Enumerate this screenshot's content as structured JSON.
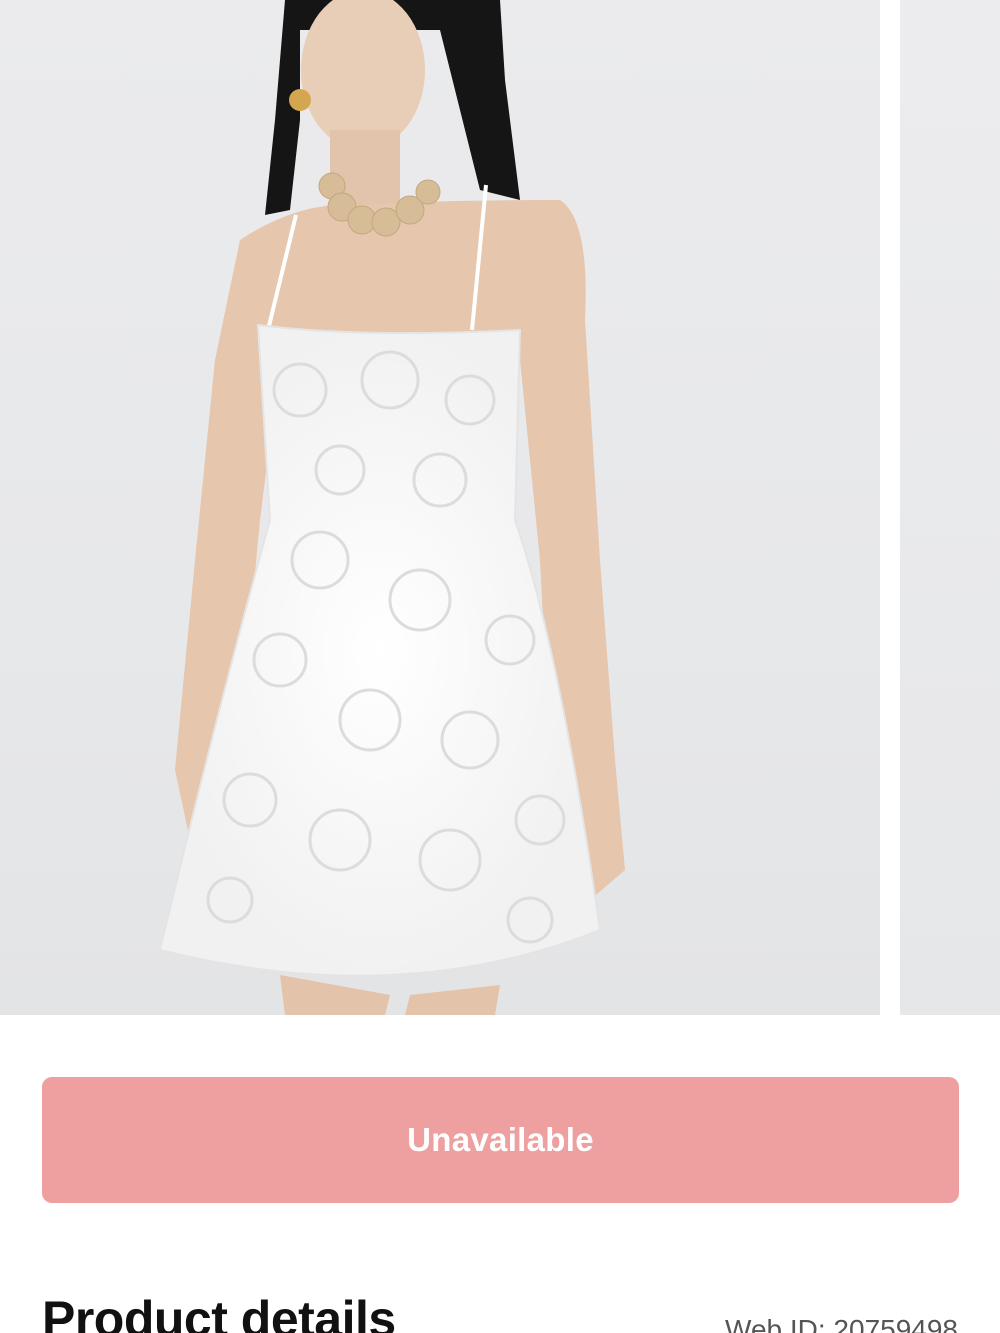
{
  "gallery": {
    "current_image": "model-white-lace-mini-dress",
    "next_image": "product-image-2"
  },
  "purchase": {
    "button_label": "Unavailable",
    "button_color": "#ee9fa0"
  },
  "details": {
    "title": "Product details",
    "web_id": "Web ID: 20759498"
  }
}
